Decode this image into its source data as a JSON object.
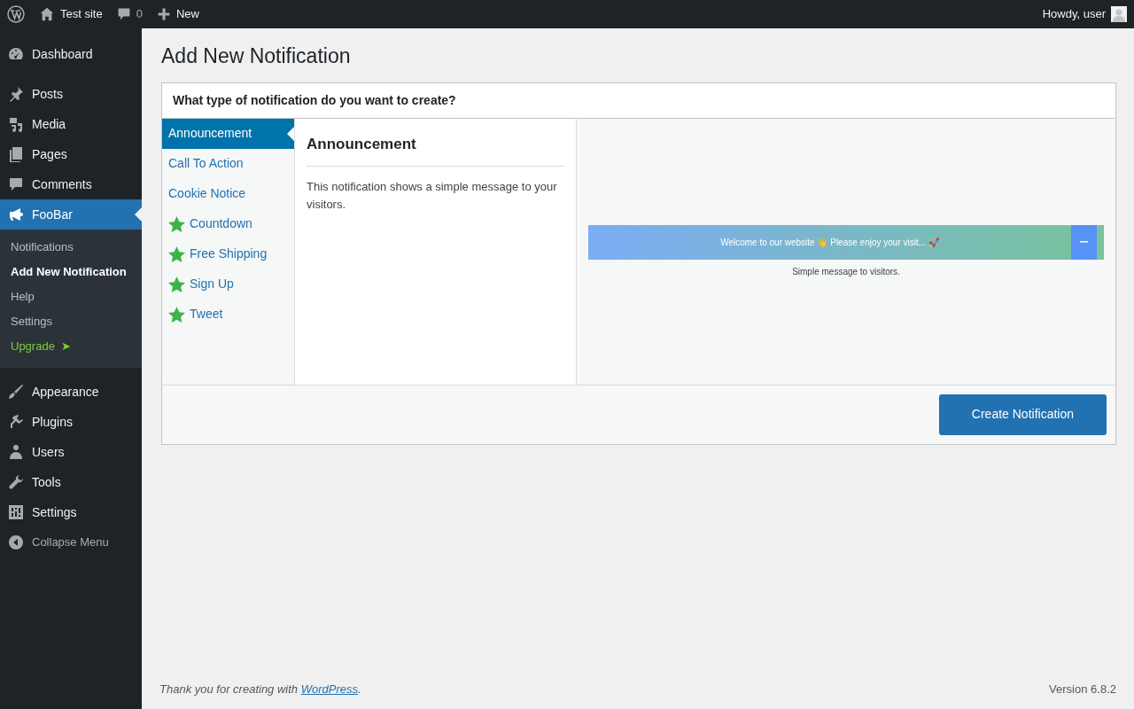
{
  "admin_bar": {
    "site_name": "Test site",
    "comments_count": "0",
    "new_label": "New",
    "greeting": "Howdy, user"
  },
  "menu": [
    {
      "label": "Dashboard",
      "selected": false
    },
    {
      "label": "Posts",
      "selected": false
    },
    {
      "label": "Media",
      "selected": false
    },
    {
      "label": "Pages",
      "selected": false
    },
    {
      "label": "Comments",
      "selected": false
    },
    {
      "label": "FooBar",
      "selected": true,
      "children": [
        {
          "label": "Notifications",
          "kind": "link",
          "selected": false
        },
        {
          "label": "Add New Notification",
          "kind": "link",
          "selected": true
        },
        {
          "label": "Help",
          "kind": "link",
          "selected": false
        },
        {
          "label": "Settings",
          "kind": "link",
          "selected": false
        },
        {
          "label": "Upgrade",
          "kind": "upgrade",
          "selected": false,
          "arrow": "➤"
        }
      ]
    },
    {
      "label": "Appearance",
      "selected": false
    },
    {
      "label": "Plugins",
      "selected": false
    },
    {
      "label": "Users",
      "selected": false
    },
    {
      "label": "Tools",
      "selected": false
    },
    {
      "label": "Settings",
      "selected": false
    }
  ],
  "collapse_label": "Collapse Menu",
  "page_title": "Add New Notification",
  "question": "What type of notification do you want to create?",
  "types": [
    {
      "label": "Announcement",
      "premium": false,
      "selected": true
    },
    {
      "label": "Call To Action",
      "premium": false,
      "selected": false
    },
    {
      "label": "Cookie Notice",
      "premium": false,
      "selected": false
    },
    {
      "label": "Countdown",
      "premium": true,
      "selected": false
    },
    {
      "label": "Free Shipping",
      "premium": true,
      "selected": false
    },
    {
      "label": "Sign Up",
      "premium": true,
      "selected": false
    },
    {
      "label": "Tweet",
      "premium": true,
      "selected": false
    }
  ],
  "detail": {
    "title": "Announcement",
    "description": "This notification shows a simple message to your visitors."
  },
  "preview": {
    "banner_text": "Welcome to our website 👋 Please enjoy your visit... 🚀",
    "caption": "Simple message to visitors."
  },
  "create_button": "Create Notification",
  "footer": {
    "link": "WordPress",
    "after": ".",
    "before": "Thank you for creating with ",
    "version": "Version 6.8.2"
  }
}
